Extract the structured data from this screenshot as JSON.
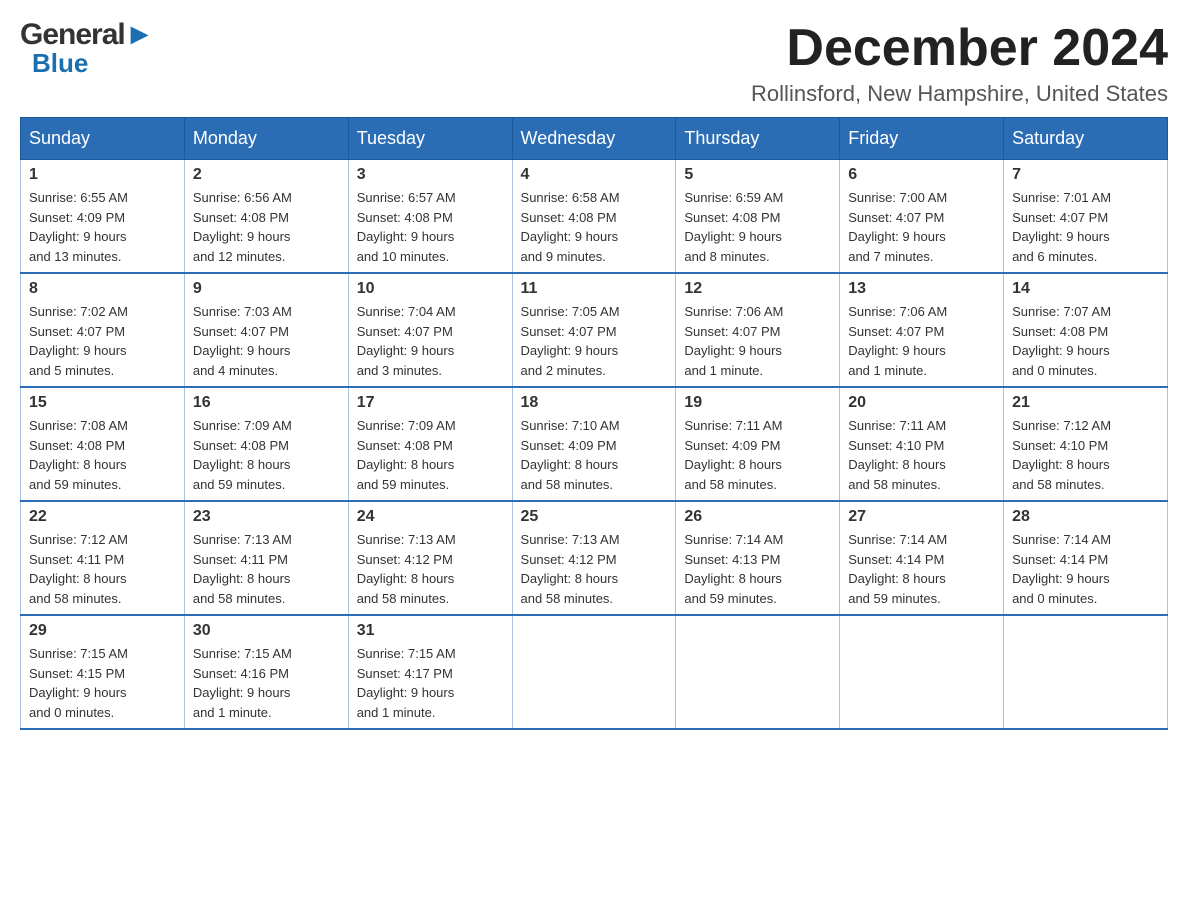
{
  "logo": {
    "general": "General",
    "arrow": "▶",
    "blue": "Blue"
  },
  "title": {
    "month": "December 2024",
    "location": "Rollinsford, New Hampshire, United States"
  },
  "headers": [
    "Sunday",
    "Monday",
    "Tuesday",
    "Wednesday",
    "Thursday",
    "Friday",
    "Saturday"
  ],
  "weeks": [
    [
      {
        "day": "1",
        "info": "Sunrise: 6:55 AM\nSunset: 4:09 PM\nDaylight: 9 hours\nand 13 minutes."
      },
      {
        "day": "2",
        "info": "Sunrise: 6:56 AM\nSunset: 4:08 PM\nDaylight: 9 hours\nand 12 minutes."
      },
      {
        "day": "3",
        "info": "Sunrise: 6:57 AM\nSunset: 4:08 PM\nDaylight: 9 hours\nand 10 minutes."
      },
      {
        "day": "4",
        "info": "Sunrise: 6:58 AM\nSunset: 4:08 PM\nDaylight: 9 hours\nand 9 minutes."
      },
      {
        "day": "5",
        "info": "Sunrise: 6:59 AM\nSunset: 4:08 PM\nDaylight: 9 hours\nand 8 minutes."
      },
      {
        "day": "6",
        "info": "Sunrise: 7:00 AM\nSunset: 4:07 PM\nDaylight: 9 hours\nand 7 minutes."
      },
      {
        "day": "7",
        "info": "Sunrise: 7:01 AM\nSunset: 4:07 PM\nDaylight: 9 hours\nand 6 minutes."
      }
    ],
    [
      {
        "day": "8",
        "info": "Sunrise: 7:02 AM\nSunset: 4:07 PM\nDaylight: 9 hours\nand 5 minutes."
      },
      {
        "day": "9",
        "info": "Sunrise: 7:03 AM\nSunset: 4:07 PM\nDaylight: 9 hours\nand 4 minutes."
      },
      {
        "day": "10",
        "info": "Sunrise: 7:04 AM\nSunset: 4:07 PM\nDaylight: 9 hours\nand 3 minutes."
      },
      {
        "day": "11",
        "info": "Sunrise: 7:05 AM\nSunset: 4:07 PM\nDaylight: 9 hours\nand 2 minutes."
      },
      {
        "day": "12",
        "info": "Sunrise: 7:06 AM\nSunset: 4:07 PM\nDaylight: 9 hours\nand 1 minute."
      },
      {
        "day": "13",
        "info": "Sunrise: 7:06 AM\nSunset: 4:07 PM\nDaylight: 9 hours\nand 1 minute."
      },
      {
        "day": "14",
        "info": "Sunrise: 7:07 AM\nSunset: 4:08 PM\nDaylight: 9 hours\nand 0 minutes."
      }
    ],
    [
      {
        "day": "15",
        "info": "Sunrise: 7:08 AM\nSunset: 4:08 PM\nDaylight: 8 hours\nand 59 minutes."
      },
      {
        "day": "16",
        "info": "Sunrise: 7:09 AM\nSunset: 4:08 PM\nDaylight: 8 hours\nand 59 minutes."
      },
      {
        "day": "17",
        "info": "Sunrise: 7:09 AM\nSunset: 4:08 PM\nDaylight: 8 hours\nand 59 minutes."
      },
      {
        "day": "18",
        "info": "Sunrise: 7:10 AM\nSunset: 4:09 PM\nDaylight: 8 hours\nand 58 minutes."
      },
      {
        "day": "19",
        "info": "Sunrise: 7:11 AM\nSunset: 4:09 PM\nDaylight: 8 hours\nand 58 minutes."
      },
      {
        "day": "20",
        "info": "Sunrise: 7:11 AM\nSunset: 4:10 PM\nDaylight: 8 hours\nand 58 minutes."
      },
      {
        "day": "21",
        "info": "Sunrise: 7:12 AM\nSunset: 4:10 PM\nDaylight: 8 hours\nand 58 minutes."
      }
    ],
    [
      {
        "day": "22",
        "info": "Sunrise: 7:12 AM\nSunset: 4:11 PM\nDaylight: 8 hours\nand 58 minutes."
      },
      {
        "day": "23",
        "info": "Sunrise: 7:13 AM\nSunset: 4:11 PM\nDaylight: 8 hours\nand 58 minutes."
      },
      {
        "day": "24",
        "info": "Sunrise: 7:13 AM\nSunset: 4:12 PM\nDaylight: 8 hours\nand 58 minutes."
      },
      {
        "day": "25",
        "info": "Sunrise: 7:13 AM\nSunset: 4:12 PM\nDaylight: 8 hours\nand 58 minutes."
      },
      {
        "day": "26",
        "info": "Sunrise: 7:14 AM\nSunset: 4:13 PM\nDaylight: 8 hours\nand 59 minutes."
      },
      {
        "day": "27",
        "info": "Sunrise: 7:14 AM\nSunset: 4:14 PM\nDaylight: 8 hours\nand 59 minutes."
      },
      {
        "day": "28",
        "info": "Sunrise: 7:14 AM\nSunset: 4:14 PM\nDaylight: 9 hours\nand 0 minutes."
      }
    ],
    [
      {
        "day": "29",
        "info": "Sunrise: 7:15 AM\nSunset: 4:15 PM\nDaylight: 9 hours\nand 0 minutes."
      },
      {
        "day": "30",
        "info": "Sunrise: 7:15 AM\nSunset: 4:16 PM\nDaylight: 9 hours\nand 1 minute."
      },
      {
        "day": "31",
        "info": "Sunrise: 7:15 AM\nSunset: 4:17 PM\nDaylight: 9 hours\nand 1 minute."
      },
      {
        "day": "",
        "info": ""
      },
      {
        "day": "",
        "info": ""
      },
      {
        "day": "",
        "info": ""
      },
      {
        "day": "",
        "info": ""
      }
    ]
  ]
}
